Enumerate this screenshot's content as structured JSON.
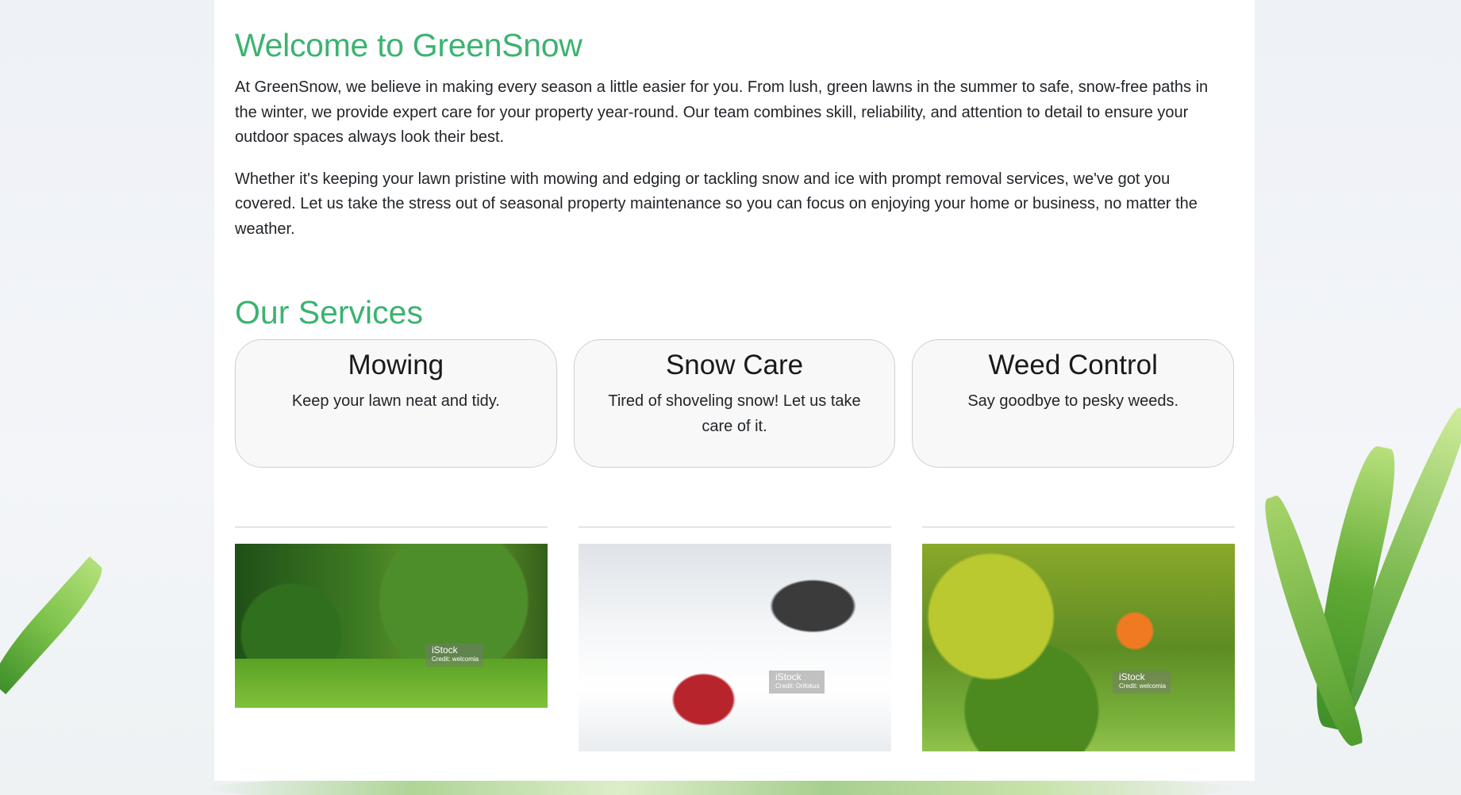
{
  "intro": {
    "title": "Welcome to GreenSnow",
    "paragraph1": "At GreenSnow, we believe in making every season a little easier for you. From lush, green lawns in the summer to safe, snow-free paths in the winter, we provide expert care for your property year-round. Our team combines skill, reliability, and attention to detail to ensure your outdoor spaces always look their best.",
    "paragraph2": "Whether it's keeping your lawn pristine with mowing and edging or tackling snow and ice with prompt removal services, we've got you covered. Let us take the stress out of seasonal property maintenance so you can focus on enjoying your home or business, no matter the weather."
  },
  "services": {
    "title": "Our Services",
    "cards": [
      {
        "title": "Mowing",
        "description": "Keep your lawn neat and tidy."
      },
      {
        "title": "Snow Care",
        "description": "Tired of shoveling snow! Let us take care of it."
      },
      {
        "title": "Weed Control",
        "description": "Say goodbye to pesky weeds."
      }
    ]
  },
  "gallery": {
    "images": [
      {
        "subject": "lawn-mowing-photo",
        "watermark": "iStock",
        "credit": "Credit: welcomia"
      },
      {
        "subject": "snow-blower-photo",
        "watermark": "iStock",
        "credit": "Credit: Orifokus"
      },
      {
        "subject": "gardener-weeding-photo",
        "watermark": "iStock",
        "credit": "Credit: welcomia"
      }
    ]
  },
  "theme": {
    "accent": "#3cb371",
    "text": "#212529",
    "card_background": "#f8f8f8"
  }
}
